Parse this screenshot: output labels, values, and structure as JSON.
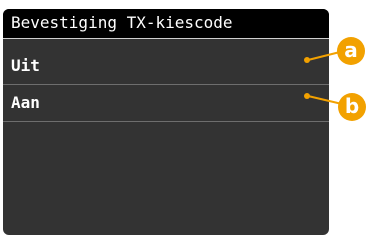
{
  "screen": {
    "title": "Bevestiging TX-kiescode",
    "options": [
      {
        "label": "Uit"
      },
      {
        "label": "Aan"
      }
    ]
  },
  "callouts": [
    {
      "label": "a"
    },
    {
      "label": "b"
    }
  ],
  "colors": {
    "screen_background": "#333333",
    "title_background": "#000000",
    "callout_accent": "#f2a100",
    "text": "#ffffff"
  }
}
